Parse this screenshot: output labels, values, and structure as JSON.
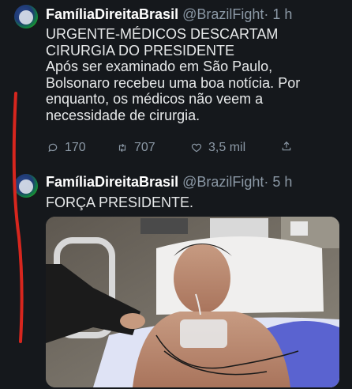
{
  "tweets": [
    {
      "display_name": "FamíliaDireitaBrasil",
      "handle": "@BrazilFight",
      "separator": "·",
      "time": "1 h",
      "lines": [
        "URGENTE-MÉDICOS DESCARTAM",
        "CIRURGIA DO PRESIDENTE",
        "Após ser examinado em São Paulo,",
        "Bolsonaro recebeu uma boa notícia. Por",
        "enquanto, os médicos não  veem a",
        "necessidade de cirurgia."
      ],
      "replies": "170",
      "retweets": "707",
      "likes": "3,5 mil"
    },
    {
      "display_name": "FamíliaDireitaBrasil",
      "handle": "@BrazilFight",
      "separator": "·",
      "time": "5 h",
      "text": "FORÇA PRESIDENTE."
    }
  ],
  "icons": [
    "reply-icon",
    "retweet-icon",
    "like-icon",
    "share-icon"
  ],
  "colors": {
    "background": "#15181c",
    "text": "#e7e9ea",
    "muted": "#8b98a5",
    "annotation_line": "#d7261e"
  }
}
